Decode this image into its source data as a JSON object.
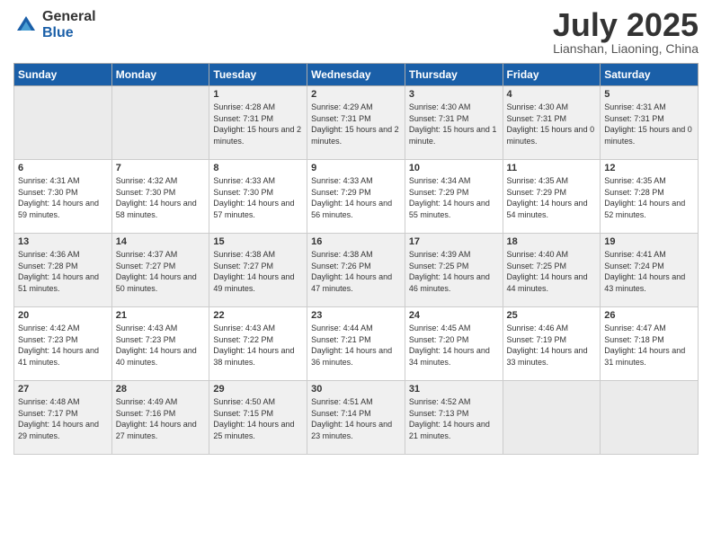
{
  "logo": {
    "general": "General",
    "blue": "Blue"
  },
  "title": "July 2025",
  "location": "Lianshan, Liaoning, China",
  "weekdays": [
    "Sunday",
    "Monday",
    "Tuesday",
    "Wednesday",
    "Thursday",
    "Friday",
    "Saturday"
  ],
  "weeks": [
    [
      {
        "day": "",
        "info": ""
      },
      {
        "day": "",
        "info": ""
      },
      {
        "day": "1",
        "info": "Sunrise: 4:28 AM\nSunset: 7:31 PM\nDaylight: 15 hours\nand 2 minutes."
      },
      {
        "day": "2",
        "info": "Sunrise: 4:29 AM\nSunset: 7:31 PM\nDaylight: 15 hours\nand 2 minutes."
      },
      {
        "day": "3",
        "info": "Sunrise: 4:30 AM\nSunset: 7:31 PM\nDaylight: 15 hours\nand 1 minute."
      },
      {
        "day": "4",
        "info": "Sunrise: 4:30 AM\nSunset: 7:31 PM\nDaylight: 15 hours\nand 0 minutes."
      },
      {
        "day": "5",
        "info": "Sunrise: 4:31 AM\nSunset: 7:31 PM\nDaylight: 15 hours\nand 0 minutes."
      }
    ],
    [
      {
        "day": "6",
        "info": "Sunrise: 4:31 AM\nSunset: 7:30 PM\nDaylight: 14 hours\nand 59 minutes."
      },
      {
        "day": "7",
        "info": "Sunrise: 4:32 AM\nSunset: 7:30 PM\nDaylight: 14 hours\nand 58 minutes."
      },
      {
        "day": "8",
        "info": "Sunrise: 4:33 AM\nSunset: 7:30 PM\nDaylight: 14 hours\nand 57 minutes."
      },
      {
        "day": "9",
        "info": "Sunrise: 4:33 AM\nSunset: 7:29 PM\nDaylight: 14 hours\nand 56 minutes."
      },
      {
        "day": "10",
        "info": "Sunrise: 4:34 AM\nSunset: 7:29 PM\nDaylight: 14 hours\nand 55 minutes."
      },
      {
        "day": "11",
        "info": "Sunrise: 4:35 AM\nSunset: 7:29 PM\nDaylight: 14 hours\nand 54 minutes."
      },
      {
        "day": "12",
        "info": "Sunrise: 4:35 AM\nSunset: 7:28 PM\nDaylight: 14 hours\nand 52 minutes."
      }
    ],
    [
      {
        "day": "13",
        "info": "Sunrise: 4:36 AM\nSunset: 7:28 PM\nDaylight: 14 hours\nand 51 minutes."
      },
      {
        "day": "14",
        "info": "Sunrise: 4:37 AM\nSunset: 7:27 PM\nDaylight: 14 hours\nand 50 minutes."
      },
      {
        "day": "15",
        "info": "Sunrise: 4:38 AM\nSunset: 7:27 PM\nDaylight: 14 hours\nand 49 minutes."
      },
      {
        "day": "16",
        "info": "Sunrise: 4:38 AM\nSunset: 7:26 PM\nDaylight: 14 hours\nand 47 minutes."
      },
      {
        "day": "17",
        "info": "Sunrise: 4:39 AM\nSunset: 7:25 PM\nDaylight: 14 hours\nand 46 minutes."
      },
      {
        "day": "18",
        "info": "Sunrise: 4:40 AM\nSunset: 7:25 PM\nDaylight: 14 hours\nand 44 minutes."
      },
      {
        "day": "19",
        "info": "Sunrise: 4:41 AM\nSunset: 7:24 PM\nDaylight: 14 hours\nand 43 minutes."
      }
    ],
    [
      {
        "day": "20",
        "info": "Sunrise: 4:42 AM\nSunset: 7:23 PM\nDaylight: 14 hours\nand 41 minutes."
      },
      {
        "day": "21",
        "info": "Sunrise: 4:43 AM\nSunset: 7:23 PM\nDaylight: 14 hours\nand 40 minutes."
      },
      {
        "day": "22",
        "info": "Sunrise: 4:43 AM\nSunset: 7:22 PM\nDaylight: 14 hours\nand 38 minutes."
      },
      {
        "day": "23",
        "info": "Sunrise: 4:44 AM\nSunset: 7:21 PM\nDaylight: 14 hours\nand 36 minutes."
      },
      {
        "day": "24",
        "info": "Sunrise: 4:45 AM\nSunset: 7:20 PM\nDaylight: 14 hours\nand 34 minutes."
      },
      {
        "day": "25",
        "info": "Sunrise: 4:46 AM\nSunset: 7:19 PM\nDaylight: 14 hours\nand 33 minutes."
      },
      {
        "day": "26",
        "info": "Sunrise: 4:47 AM\nSunset: 7:18 PM\nDaylight: 14 hours\nand 31 minutes."
      }
    ],
    [
      {
        "day": "27",
        "info": "Sunrise: 4:48 AM\nSunset: 7:17 PM\nDaylight: 14 hours\nand 29 minutes."
      },
      {
        "day": "28",
        "info": "Sunrise: 4:49 AM\nSunset: 7:16 PM\nDaylight: 14 hours\nand 27 minutes."
      },
      {
        "day": "29",
        "info": "Sunrise: 4:50 AM\nSunset: 7:15 PM\nDaylight: 14 hours\nand 25 minutes."
      },
      {
        "day": "30",
        "info": "Sunrise: 4:51 AM\nSunset: 7:14 PM\nDaylight: 14 hours\nand 23 minutes."
      },
      {
        "day": "31",
        "info": "Sunrise: 4:52 AM\nSunset: 7:13 PM\nDaylight: 14 hours\nand 21 minutes."
      },
      {
        "day": "",
        "info": ""
      },
      {
        "day": "",
        "info": ""
      }
    ]
  ]
}
